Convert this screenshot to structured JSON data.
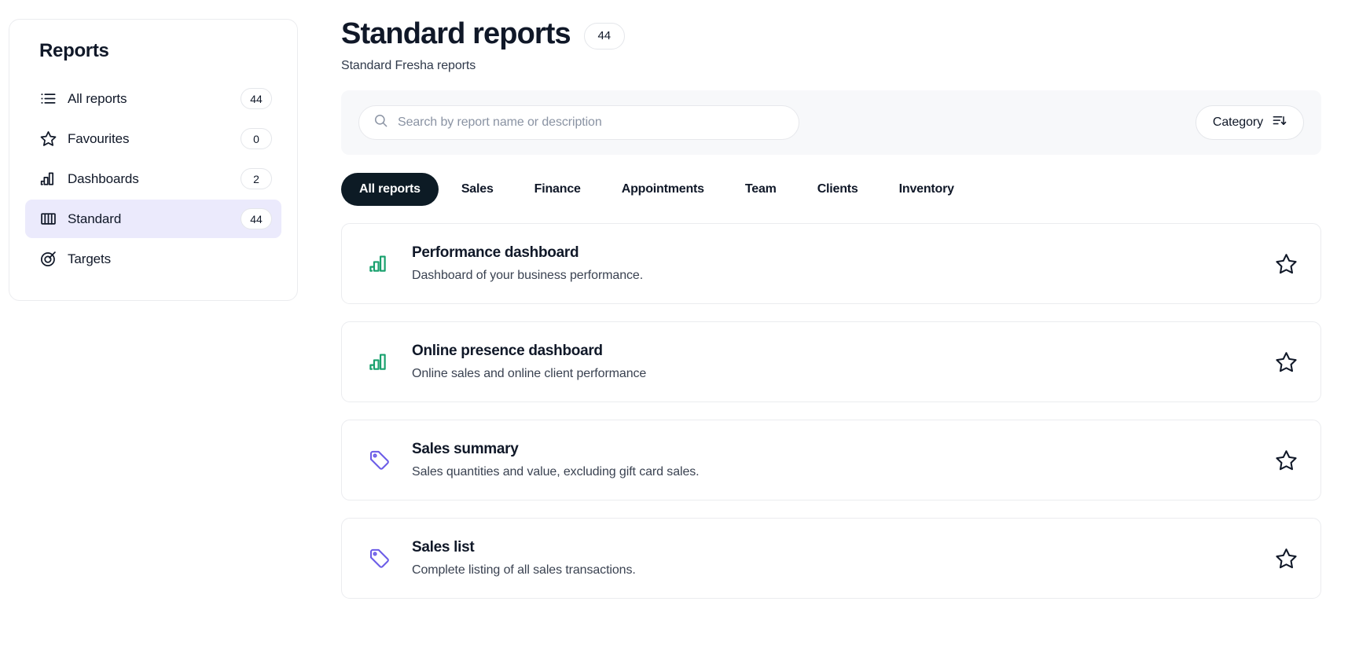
{
  "sidebar": {
    "title": "Reports",
    "items": [
      {
        "label": "All reports",
        "badge": "44",
        "icon": "list-icon",
        "active": false
      },
      {
        "label": "Favourites",
        "badge": "0",
        "icon": "star-icon",
        "active": false
      },
      {
        "label": "Dashboards",
        "badge": "2",
        "icon": "bar-chart-icon",
        "active": false
      },
      {
        "label": "Standard",
        "badge": "44",
        "icon": "columns-icon",
        "active": true
      },
      {
        "label": "Targets",
        "badge": "",
        "icon": "target-icon",
        "active": false
      }
    ]
  },
  "header": {
    "title": "Standard reports",
    "count_badge": "44",
    "subtitle": "Standard Fresha reports"
  },
  "search": {
    "placeholder": "Search by report name or description",
    "value": ""
  },
  "category_button": {
    "label": "Category",
    "icon": "sort-descending-icon"
  },
  "tabs": [
    {
      "label": "All reports",
      "active": true
    },
    {
      "label": "Sales",
      "active": false
    },
    {
      "label": "Finance",
      "active": false
    },
    {
      "label": "Appointments",
      "active": false
    },
    {
      "label": "Team",
      "active": false
    },
    {
      "label": "Clients",
      "active": false
    },
    {
      "label": "Inventory",
      "active": false
    }
  ],
  "reports": [
    {
      "name": "Performance dashboard",
      "description": "Dashboard of your business performance.",
      "icon": "bar-chart-icon",
      "icon_color": "#18a06d",
      "favourite": false
    },
    {
      "name": "Online presence dashboard",
      "description": "Online sales and online client performance",
      "icon": "bar-chart-icon",
      "icon_color": "#18a06d",
      "favourite": false
    },
    {
      "name": "Sales summary",
      "description": "Sales quantities and value, excluding gift card sales.",
      "icon": "tag-icon",
      "icon_color": "#6b5ce7",
      "favourite": false
    },
    {
      "name": "Sales list",
      "description": "Complete listing of all sales transactions.",
      "icon": "tag-icon",
      "icon_color": "#6b5ce7",
      "favourite": false
    }
  ],
  "colors": {
    "active_nav_bg": "#ebeafc",
    "active_tab_bg": "#0d1b25",
    "strip_bg": "#f7f8fa",
    "green_icon": "#18a06d",
    "purple_icon": "#6b5ce7"
  }
}
